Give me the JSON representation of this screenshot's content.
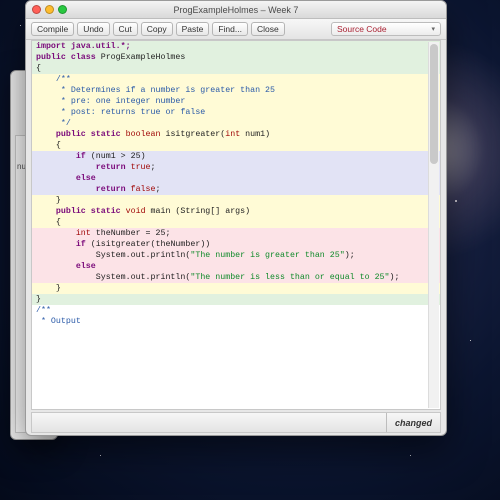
{
  "desktop": {
    "bg_window_label": "numbe"
  },
  "window": {
    "title": "ProgExampleHolmes – Week 7",
    "toolbar": {
      "compile": "Compile",
      "undo": "Undo",
      "cut": "Cut",
      "copy": "Copy",
      "paste": "Paste",
      "find": "Find...",
      "close": "Close",
      "dropdown_selected": "Source Code"
    },
    "status": {
      "changed": "changed"
    }
  },
  "code": {
    "l01": "import java.util.*;",
    "l02": "",
    "l03_a": "public",
    "l03_b": " class",
    "l03_c": " ProgExampleHolmes",
    "l04": "{",
    "l05": "    /**",
    "l06": "     * Determines if a number is greater than 25",
    "l07": "     * pre: one integer number",
    "l08": "     * post: returns true or false",
    "l09": "     */",
    "l10_a": "    public",
    "l10_b": " static",
    "l10_c": " boolean",
    "l10_d": " isitgreater(",
    "l10_e": "int",
    "l10_f": " num1)",
    "l11": "    {",
    "l12_a": "        if",
    "l12_b": " (num1 > 25)",
    "l13_a": "            return",
    "l13_b": " true",
    "l13_c": ";",
    "l14": "        else",
    "l15_a": "            return",
    "l15_b": " false",
    "l15_c": ";",
    "l16": "    }",
    "l17": "",
    "l18_a": "    public",
    "l18_b": " static",
    "l18_c": " void",
    "l18_d": " main (String[] args)",
    "l19": "    {",
    "l20_a": "        int",
    "l20_b": " theNumber = 25;",
    "l21_a": "        if",
    "l21_b": " (isitgreater(theNumber))",
    "l22_a": "            System.out.println(",
    "l22_b": "\"The number is greater than 25\"",
    "l22_c": ");",
    "l23": "        else",
    "l24_a": "            System.out.println(",
    "l24_b": "\"The number is less than or equal to 25\"",
    "l24_c": ");",
    "l25": "",
    "l26": "    }",
    "l27": "}",
    "l28": "/**",
    "l29": " * Output"
  }
}
